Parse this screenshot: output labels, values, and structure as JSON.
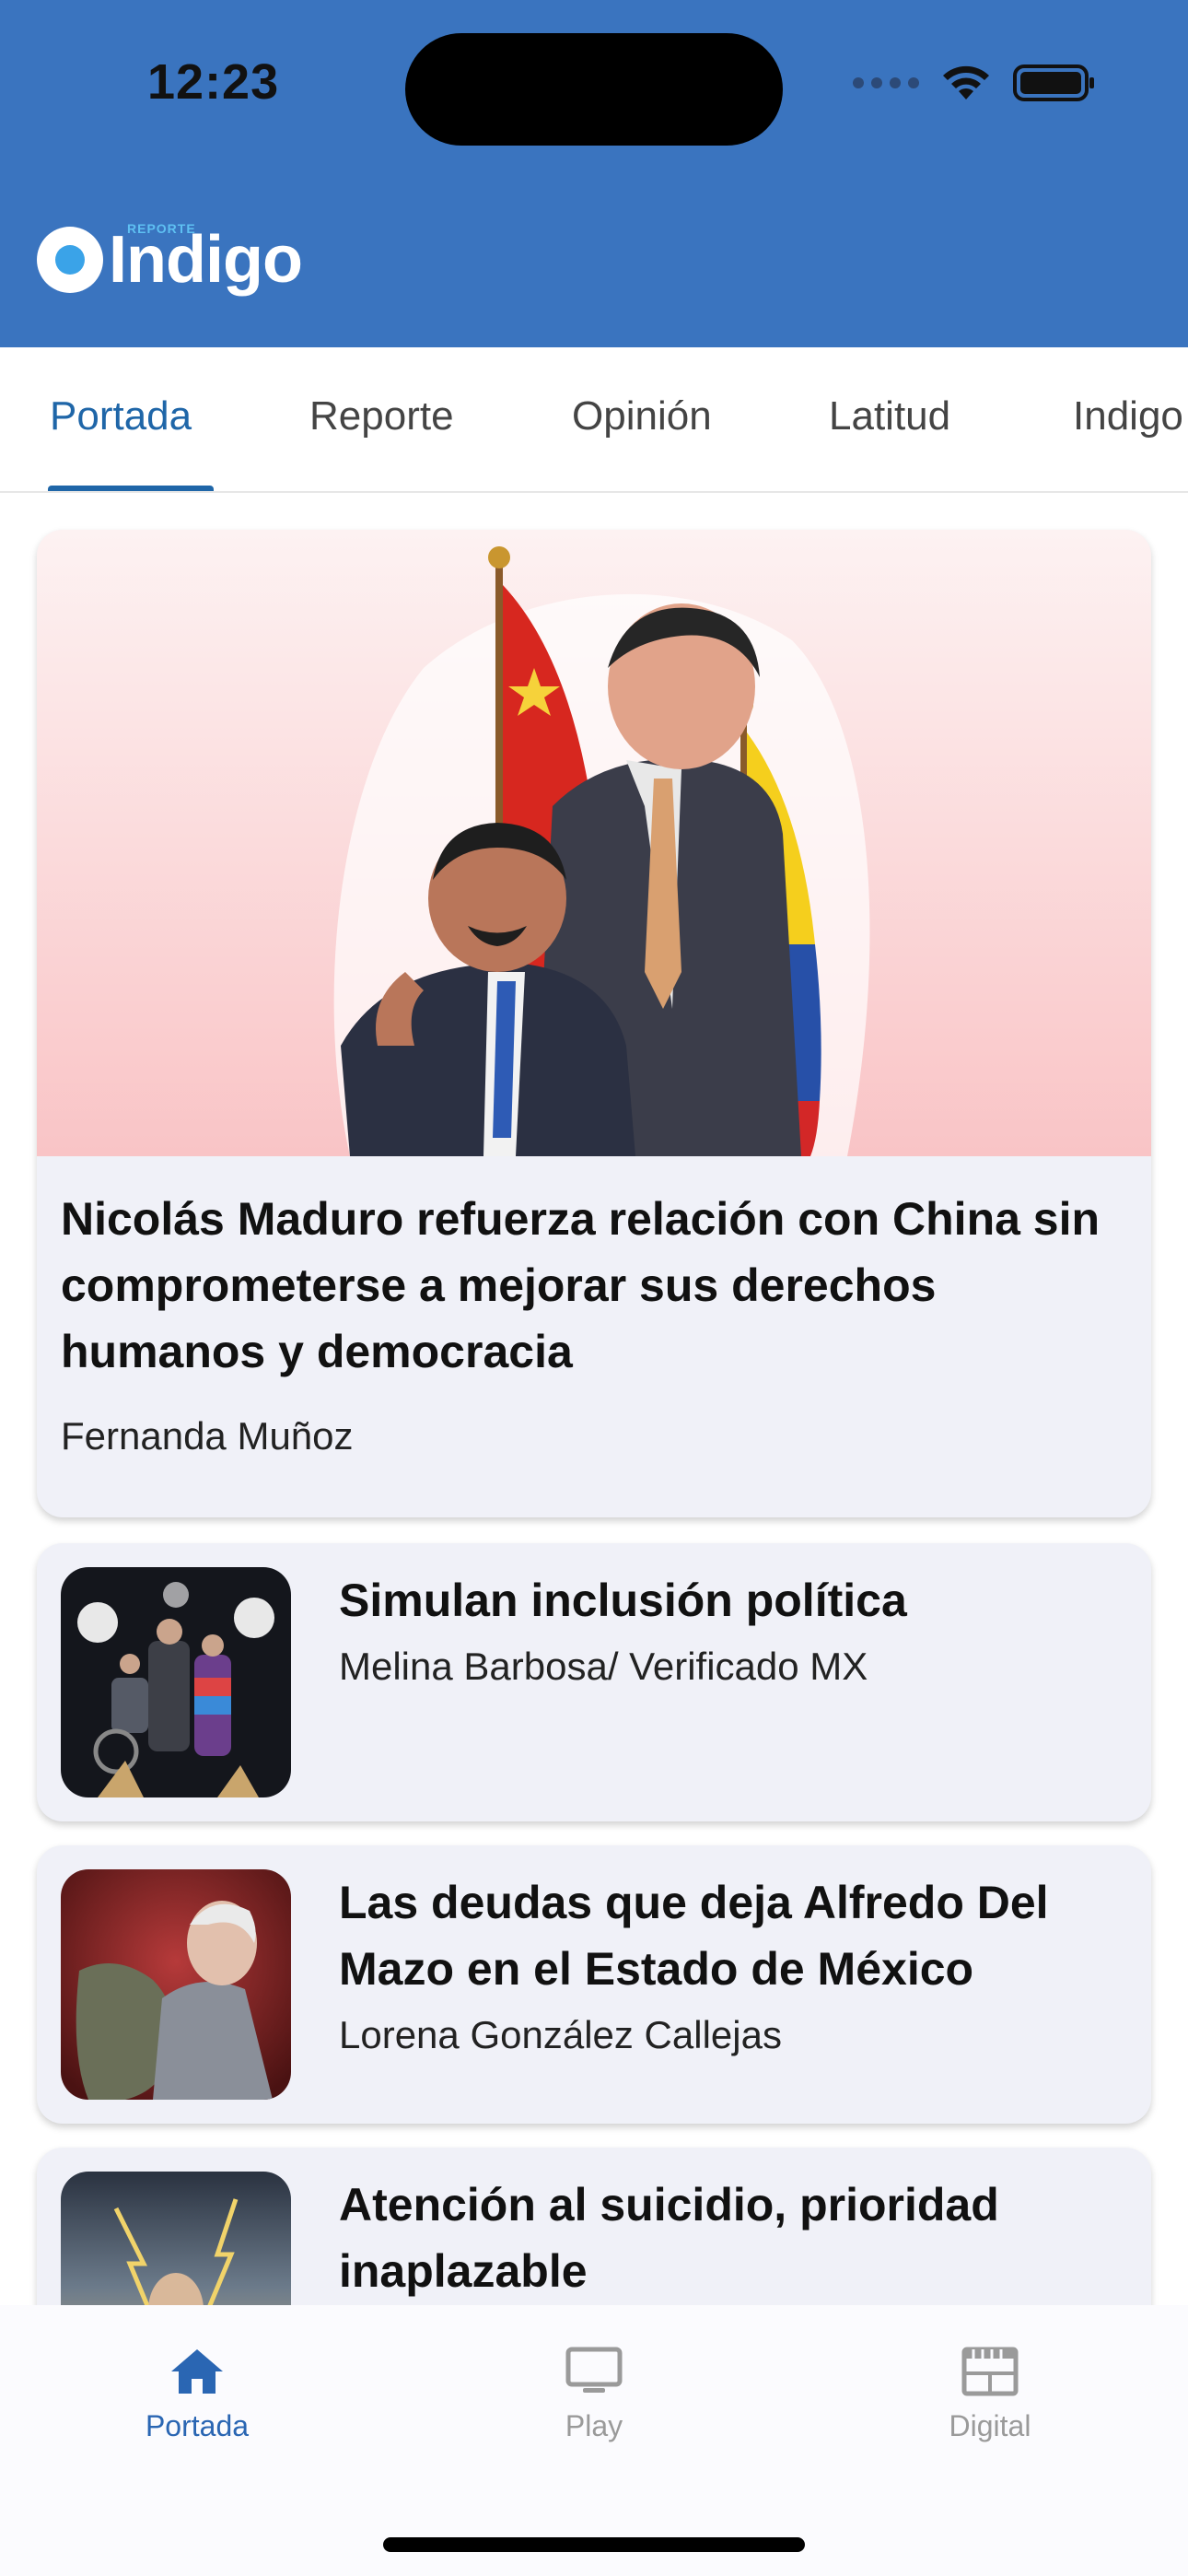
{
  "status_bar": {
    "time": "12:23",
    "icons": [
      "signal-dots-icon",
      "wifi-icon",
      "battery-icon"
    ]
  },
  "header": {
    "logo_text": "Indigo",
    "logo_subtext": "REPORTE",
    "background": "#3a74bf"
  },
  "tabs": [
    {
      "label": "Portada",
      "active": true
    },
    {
      "label": "Reporte",
      "active": false
    },
    {
      "label": "Opinión",
      "active": false
    },
    {
      "label": "Latitud",
      "active": false
    },
    {
      "label": "Indigo",
      "active": false
    }
  ],
  "feed": {
    "featured": {
      "title": "Nicolás Maduro refuerza relación con China sin comprometerse a mejorar sus derechos humanos y democracia",
      "author": "Fernanda Muñoz"
    },
    "articles": [
      {
        "title": "Simulan inclusión política",
        "author": "Melina Barbosa/ Verificado MX"
      },
      {
        "title": "Las deudas que deja Alfredo Del Mazo en el Estado de México",
        "author": "Lorena González Callejas"
      },
      {
        "title": "Atención al suicidio, prioridad inaplazable",
        "author": ""
      }
    ]
  },
  "bottom_nav": [
    {
      "label": "Portada",
      "icon": "home-icon",
      "active": true
    },
    {
      "label": "Play",
      "icon": "tv-icon",
      "active": false
    },
    {
      "label": "Digital",
      "icon": "newspaper-icon",
      "active": false
    }
  ],
  "colors": {
    "brand_blue": "#3a74bf",
    "active_tab": "#1f66a8",
    "card_bg": "#f0f1f8"
  }
}
